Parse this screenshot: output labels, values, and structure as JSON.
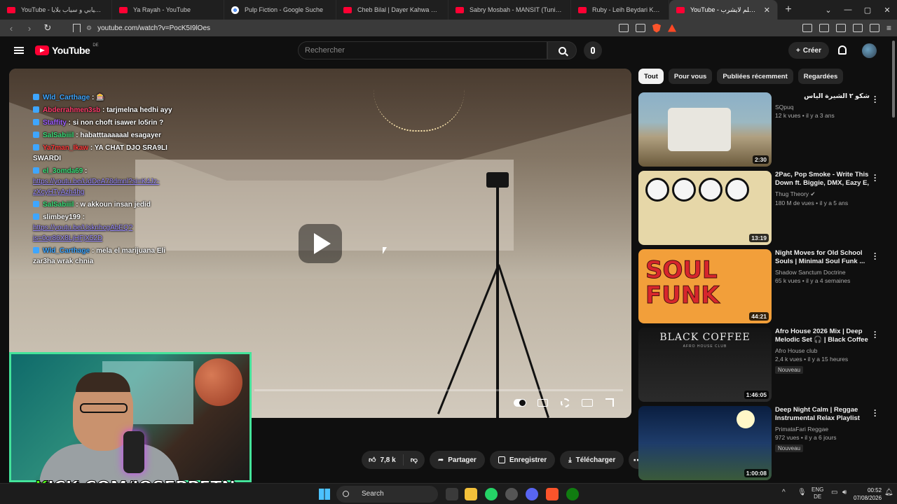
{
  "browser": {
    "tabs": [
      {
        "label": "YouTube - انتي سيابي و سياب بلايا",
        "favicon": "youtube-icon",
        "active": false
      },
      {
        "label": "Ya Rayah - YouTube",
        "favicon": "youtube-icon",
        "active": false
      },
      {
        "label": "Pulp Fiction - Google Suche",
        "favicon": "google-icon",
        "active": false
      },
      {
        "label": "Cheb Bilal | Dayer Kahwa We Cha3e",
        "favicon": "youtube-icon",
        "active": false
      },
      {
        "label": "Sabry Mosbah - MANSIT (Tunisian M",
        "favicon": "youtube-icon",
        "active": false
      },
      {
        "label": "Ruby - Leih Beydari Keda (Official M",
        "favicon": "youtube-icon",
        "active": false
      },
      {
        "label": "YouTube - المسلم لايشرب...",
        "favicon": "youtube-icon",
        "active": true
      }
    ],
    "url": "youtube.com/watch?v=PocK5I9lOes"
  },
  "youtube": {
    "logo_text": "YouTube",
    "logo_region": "DE",
    "search_placeholder": "Rechercher",
    "create_label": "Créer"
  },
  "chat": [
    {
      "user": "Wld_Carthage",
      "user_color": "#3ea6ff",
      "text": " : 🎰"
    },
    {
      "user": "Abderrahmen3sb",
      "user_color": "#ff3b6b",
      "text": " : tarjmelna hedhi ayy"
    },
    {
      "user": "Staffity",
      "user_color": "#9b5cff",
      "text": " : si non choft isawer lo5rin ?"
    },
    {
      "user": "SalSabiiil",
      "user_color": "#39e07a",
      "text": " : habatttaaaaaal esagayer"
    },
    {
      "user": "Ya7man_Ikaw",
      "user_color": "#ff3b3b",
      "text": " : YA CHAT DJO SRA9LI SWARDI"
    },
    {
      "user": "el_3omda69",
      "user_color": "#39e07a",
      "text": " : ",
      "link": "https://youtu.be/UdDeA78dmnl?si=K4Jz-zXcyHTyAzh4hg"
    },
    {
      "user": "SalSabiiil",
      "user_color": "#39e07a",
      "text": " : w akkoun insan jedid"
    },
    {
      "user": "slimbey199",
      "user_color": "#ffffff",
      "text": " : ",
      "link": "https://youtu.be/UsknhcgAbEQ?is=0qr86X8LjHFjX52D"
    },
    {
      "user": "Wld_Carthage",
      "user_color": "#3ea6ff",
      "text": " : mela el marijuana Eli zar3ha wrak chnia"
    }
  ],
  "overlay": {
    "kick_prefix": "K",
    "kick_rest": "ICK.COM/JOSEPPETN"
  },
  "actions": {
    "like_count": "7,8 k",
    "share_label": "Partager",
    "save_label": "Enregistrer",
    "download_label": "Télécharger"
  },
  "chips": [
    "Tout",
    "Pour vous",
    "Publiées récemment",
    "Regardées"
  ],
  "recommendations": [
    {
      "title": "شكو ٢ الشيرة الياس",
      "channel": "SQpuq",
      "views": "12 k vues",
      "age": "il y a 3 ans",
      "duration": "2:30",
      "verified": false,
      "new": false
    },
    {
      "title": "2Pac, Pop Smoke - Write This Down ft. Biggie, DMX, Eazy E, ...",
      "channel": "Thug Theory",
      "views": "180 M de vues",
      "age": "il y a 5 ans",
      "duration": "13:19",
      "verified": true,
      "new": false
    },
    {
      "title": "Night Moves for Old School Souls | Minimal Soul Funk ...",
      "channel": "Shadow Sanctum Doctrine",
      "views": "65 k vues",
      "age": "il y a 4 semaines",
      "duration": "44:21",
      "verified": false,
      "new": false,
      "thumb_text": "SOUL FUNK"
    },
    {
      "title": "Afro House 2026 Mix | Deep Melodic Set 🎧 | Black Coffee ...",
      "channel": "Afro House club",
      "views": "2,4 k vues",
      "age": "il y a 15 heures",
      "duration": "1:46:05",
      "verified": false,
      "new": true,
      "thumb_text": "BLACK COFFEE",
      "thumb_sub": "AFRO HOUSE CLUB"
    },
    {
      "title": "Deep Night Calm | Reggae Instrumental Relax Playlist",
      "channel": "PrimataFari Reggae",
      "views": "972 vues",
      "age": "il y a 6 jours",
      "duration": "1:00:08",
      "verified": false,
      "new": true
    }
  ],
  "new_badge": "Nouveau",
  "taskbar": {
    "search_label": "Search",
    "lang_top": "ENG",
    "lang_bottom": "DE",
    "time": "00:52",
    "date": "07/08/2026"
  }
}
